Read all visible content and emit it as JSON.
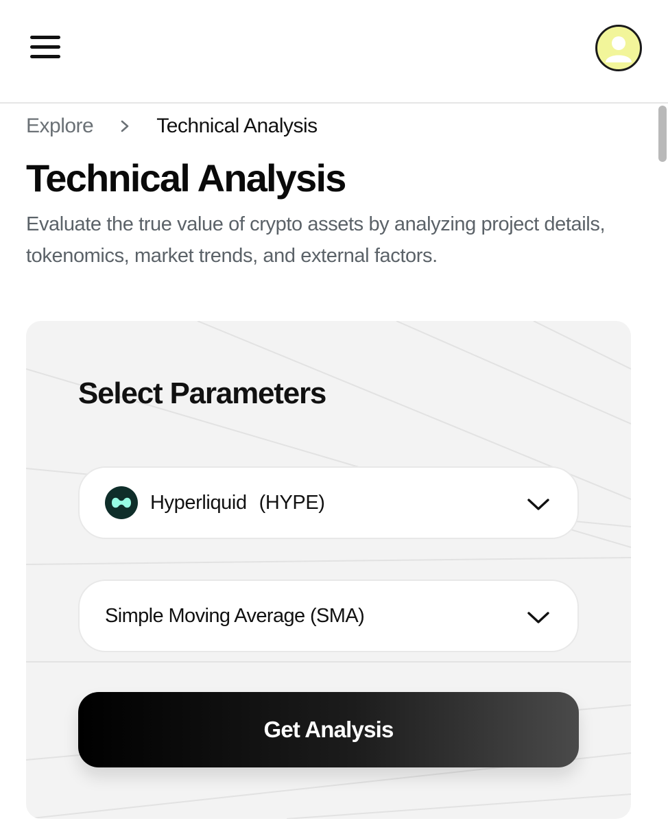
{
  "header": {
    "menu_icon": "hamburger-menu-icon",
    "avatar_icon": "user-avatar-icon",
    "avatar_color": "#f2f59a"
  },
  "breadcrumb": {
    "items": [
      "Explore",
      "Technical Analysis"
    ],
    "separator_icon": "chevron-right-icon"
  },
  "page": {
    "title": "Technical Analysis",
    "description": "Evaluate the true value of crypto assets by analyzing project details, tokenomics, market trends, and external factors."
  },
  "parameters": {
    "heading": "Select Parameters",
    "asset_select": {
      "name": "Hyperliquid",
      "ticker": "(HYPE)",
      "logo_icon": "hyperliquid-logo-icon",
      "logo_color": "#0f2e2a",
      "logo_accent": "#97fce4"
    },
    "indicator_select": {
      "value": "Simple Moving Average (SMA)"
    },
    "submit_label": "Get Analysis"
  },
  "colors": {
    "accent": "#000000",
    "card_background": "#f3f3f3",
    "muted_text": "#6b7176"
  }
}
